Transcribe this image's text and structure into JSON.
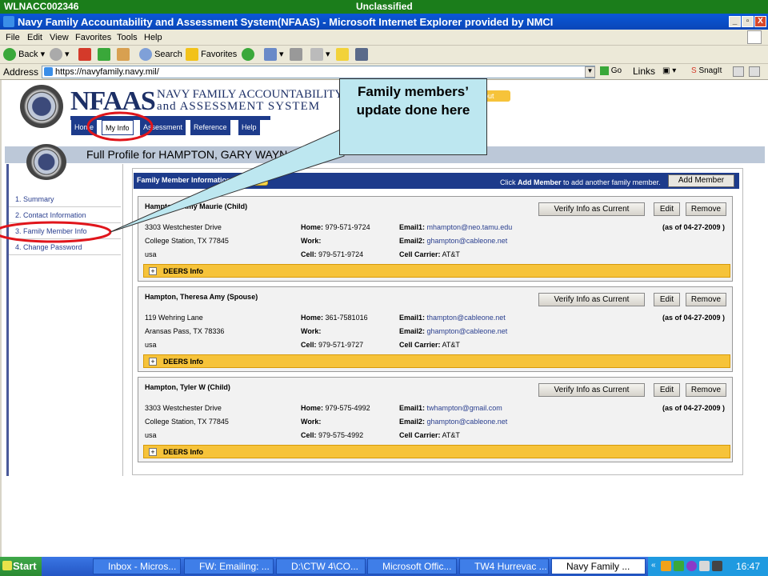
{
  "classification_bar": {
    "left": "WLNACC002346",
    "center": "Unclassified"
  },
  "window": {
    "title": "Navy Family Accountability and Assessment System(NFAAS) - Microsoft Internet Explorer provided by NMCI",
    "min": "_",
    "max": "▫",
    "close": "X"
  },
  "menu": [
    "File",
    "Edit",
    "View",
    "Favorites",
    "Tools",
    "Help"
  ],
  "toolbar": {
    "back": "Back",
    "search": "Search",
    "favorites": "Favorites"
  },
  "address": {
    "label": "Address",
    "url": "https://navyfamily.navy.mil/",
    "go": "Go",
    "links": "Links",
    "snagit": "SnagIt"
  },
  "site": {
    "logo_main": "NFAAS",
    "logo_line1": "NAVY FAMILY ACCOUNTABILITY",
    "logo_line2": "and ASSESSMENT SYSTEM",
    "nav": [
      "Home",
      "My Info",
      "Assessment",
      "Reference",
      "Help"
    ],
    "profile_title": "Full Profile for HAMPTON, GARY WAYN"
  },
  "sidebar": [
    "1. Summary",
    "2. Contact Information",
    "3. Family Member Info",
    "4. Change Password"
  ],
  "family_section": {
    "title": "Family Member Information",
    "help": "Help",
    "hint_pre": "Click ",
    "hint_bold": "Add Member",
    "hint_post": " to add another family member.",
    "add_button": "Add Member"
  },
  "buttons": {
    "verify": "Verify Info as Current",
    "edit": "Edit",
    "remove": "Remove",
    "deers": "DEERS Info",
    "expand": "+"
  },
  "labels": {
    "home": "Home:",
    "work": "Work:",
    "cell": "Cell:",
    "email1": "Email1:",
    "email2": "Email2:",
    "carrier": "Cell Carrier:"
  },
  "members": [
    {
      "name": "Hampton , Amy Maurie (Child)",
      "addr1": "3303 Westchester Drive",
      "addr2": "College Station, TX  77845",
      "country": "usa",
      "home": "979-571-9724",
      "work": "",
      "cell": "979-571-9724",
      "email1": "mhampton@neo.tamu.edu",
      "email2": "ghampton@cableone.net",
      "carrier": "AT&T",
      "asof": "(as of 04-27-2009 )"
    },
    {
      "name": "Hampton, Theresa Amy (Spouse)",
      "addr1": "119 Wehring Lane",
      "addr2": "Aransas Pass, TX  78336",
      "country": "usa",
      "home": "361-7581016",
      "work": "",
      "cell": "979-571-9727",
      "email1": "thampton@cableone.net",
      "email2": "ghampton@cableone.net",
      "carrier": "AT&T",
      "asof": "(as of 04-27-2009 )"
    },
    {
      "name": "Hampton, Tyler W (Child)",
      "addr1": "3303 Westchester Drive",
      "addr2": "College Station, TX  77845",
      "country": "usa",
      "home": "979-575-4992",
      "work": "",
      "cell": "979-575-4992",
      "email1": "twhampton@gmail.com",
      "email2": "ghampton@cableone.net",
      "carrier": "AT&T",
      "asof": "(as of 04-27-2009 )"
    }
  ],
  "callout": "Family members’ update done here",
  "taskbar": {
    "start": "Start",
    "tasks": [
      "Inbox - Micros...",
      "FW: Emailing: ...",
      "D:\\CTW 4\\CO...",
      "Microsoft Offic...",
      "TW4 Hurrevac ...",
      "Navy Family ..."
    ],
    "clock": "16:47"
  },
  "colors": {
    "nav_blue": "#1d3b8b",
    "deers_gold": "#f6c33a",
    "callout_fill": "#bde7f0",
    "highlight_red": "#e0151b"
  }
}
